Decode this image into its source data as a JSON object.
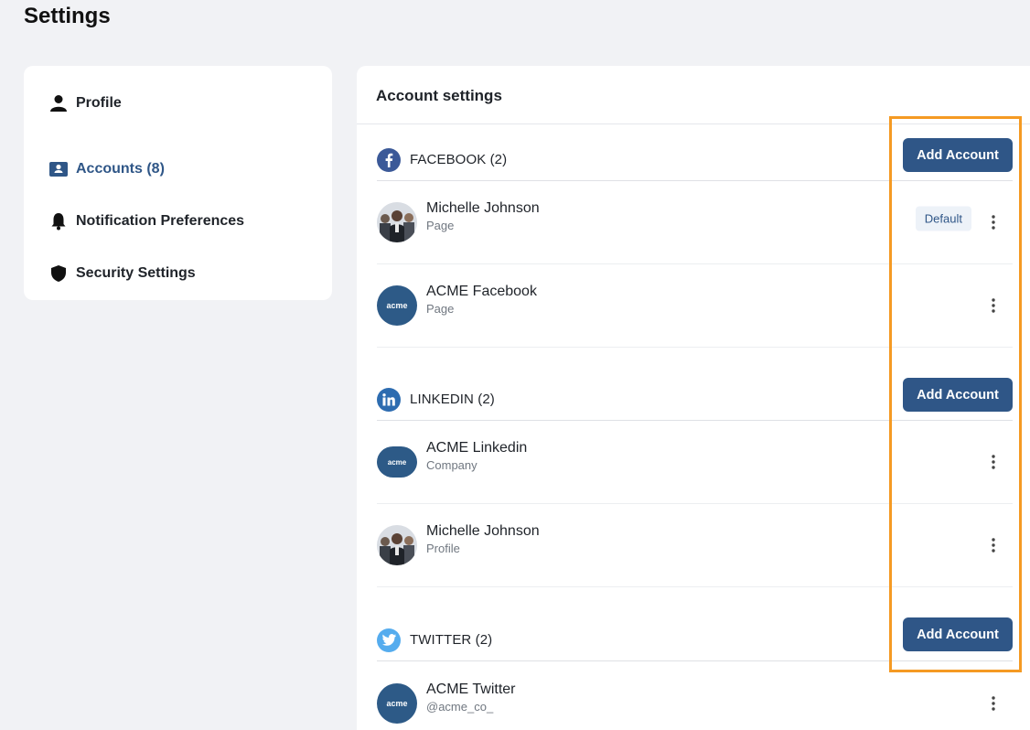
{
  "page": {
    "title": "Settings"
  },
  "sidebar": {
    "items": [
      {
        "label": "Profile",
        "icon": "person-icon",
        "active": false
      },
      {
        "label": "Accounts (8)",
        "icon": "id-card-icon",
        "active": true
      },
      {
        "label": "Notification Preferences",
        "icon": "bell-icon",
        "active": false
      },
      {
        "label": "Security Settings",
        "icon": "shield-icon",
        "active": false
      }
    ]
  },
  "main": {
    "title": "Account settings",
    "sections": [
      {
        "title": "FACEBOOK (2)",
        "icon": "facebook-icon",
        "color": "#3b5998",
        "add_label": "Add Account",
        "accounts": [
          {
            "name": "Michelle Johnson",
            "type": "Page",
            "avatar": "photo",
            "badge": "Default"
          },
          {
            "name": "ACME Facebook",
            "type": "Page",
            "avatar": "acme"
          }
        ]
      },
      {
        "title": "LINKEDIN (2)",
        "icon": "linkedin-icon",
        "color": "#2d6cb0",
        "add_label": "Add Account",
        "accounts": [
          {
            "name": "ACME Linkedin",
            "type": "Company",
            "avatar": "acme"
          },
          {
            "name": "Michelle Johnson",
            "type": "Profile",
            "avatar": "photo"
          }
        ]
      },
      {
        "title": "TWITTER (2)",
        "icon": "twitter-icon",
        "color": "#55acee",
        "add_label": "Add Account",
        "accounts": [
          {
            "name": "ACME Twitter",
            "type": "@acme_co_",
            "avatar": "acme"
          }
        ]
      }
    ]
  },
  "avatar_text": "acme",
  "colors": {
    "primary": "#2f5687",
    "highlight": "#f59a23",
    "background": "#f1f2f5"
  }
}
